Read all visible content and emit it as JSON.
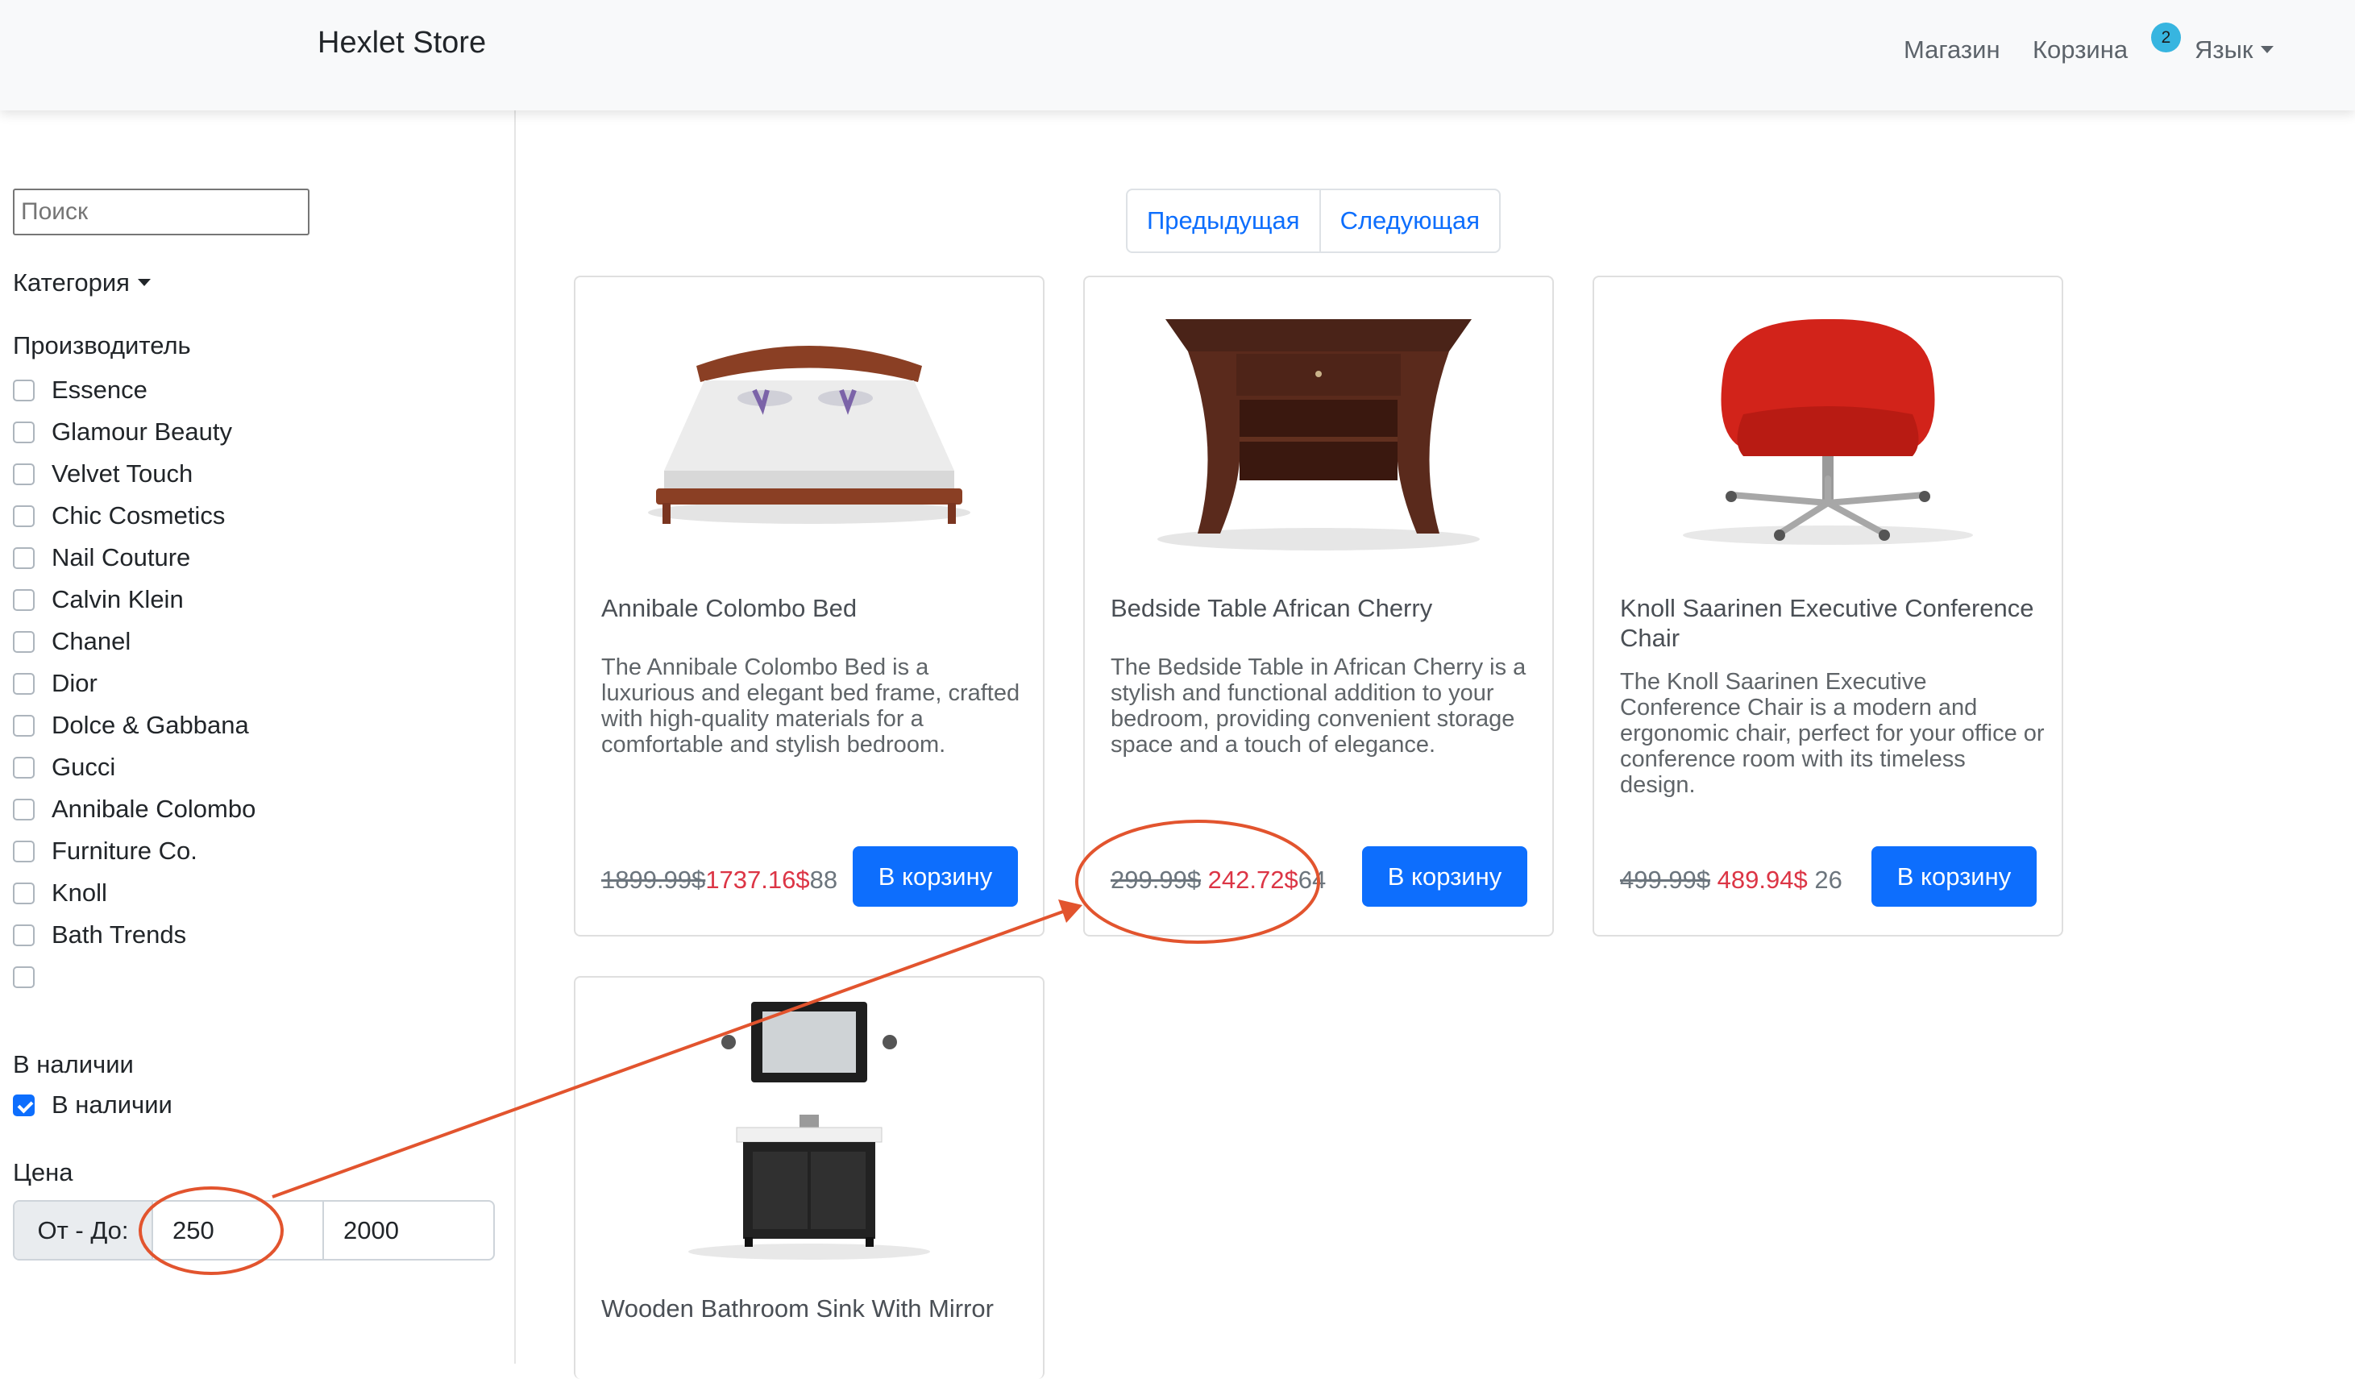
{
  "navbar": {
    "brand": "Hexlet Store",
    "shop_link": "Магазин",
    "cart_link": "Корзина",
    "cart_count": "2",
    "language_label": "Язык"
  },
  "sidebar": {
    "search_placeholder": "Поиск",
    "category_label": "Категория",
    "manufacturer_title": "Производитель",
    "manufacturers": [
      "Essence",
      "Glamour Beauty",
      "Velvet Touch",
      "Chic Cosmetics",
      "Nail Couture",
      "Calvin Klein",
      "Chanel",
      "Dior",
      "Dolce & Gabbana",
      "Gucci",
      "Annibale Colombo",
      "Furniture Co.",
      "Knoll",
      "Bath Trends",
      ""
    ],
    "availability_title": "В наличии",
    "availability_option": "В наличии",
    "availability_checked": true,
    "price_title": "Цена",
    "price_range_label": "От - До:",
    "price_min": "250",
    "price_max": "2000"
  },
  "pagination": {
    "prev_label": "Предыдущая",
    "next_label": "Следующая"
  },
  "products": [
    {
      "title": "Annibale Colombo Bed",
      "description": "The Annibale Colombo Bed is a luxurious and elegant bed frame, crafted with high-quality materials for a comfortable and stylish bedroom.",
      "old_price": "1899.99$",
      "new_price": "1737.16$",
      "stock": "88",
      "button_label": "В корзину",
      "image_icon": "bed-image"
    },
    {
      "title": "Bedside Table African Cherry",
      "description": "The Bedside Table in African Cherry is a stylish and functional addition to your bedroom, providing convenient storage space and a touch of elegance.",
      "old_price": "299.99$",
      "new_price": " 242.72$",
      "stock": "64",
      "button_label": "В корзину",
      "image_icon": "bedside-table-image"
    },
    {
      "title": "Knoll Saarinen Executive Conference Chair",
      "description": "The Knoll Saarinen Executive Conference Chair is a modern and ergonomic chair, perfect for your office or conference room with its timeless design.",
      "old_price": "499.99$",
      "new_price": " 489.94$",
      "stock": " 26",
      "button_label": "В корзину",
      "image_icon": "office-chair-image"
    },
    {
      "title": "Wooden Bathroom Sink With Mirror",
      "description": "",
      "old_price": "",
      "new_price": "",
      "stock": "",
      "button_label": "",
      "image_icon": "bathroom-sink-image"
    }
  ],
  "colors": {
    "accent": "#0d6efd",
    "sale_price": "#dc3545",
    "badge": "#37b5e0",
    "annotation": "#e2542e"
  }
}
